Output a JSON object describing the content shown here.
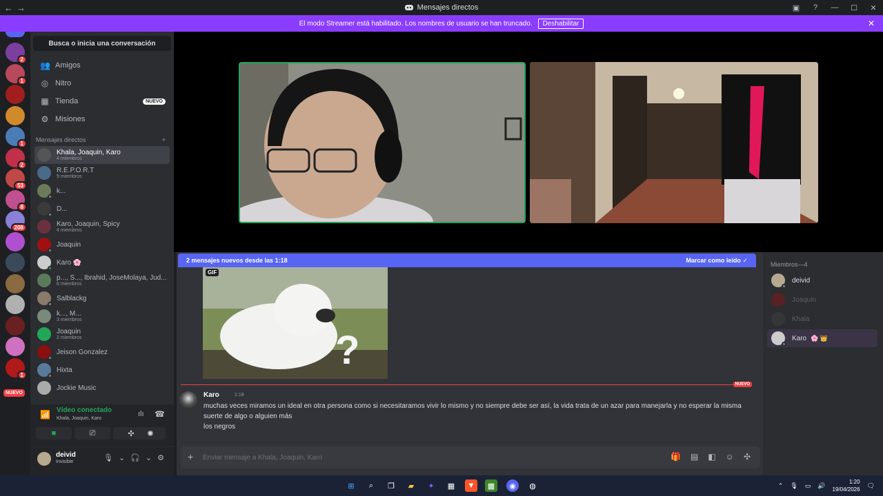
{
  "window": {
    "title": "Mensajes directos",
    "back": "←",
    "forward": "→"
  },
  "banner": {
    "text": "El modo Streamer está habilitado. Los nombres de usuario se han truncado.",
    "button": "Deshabilitar"
  },
  "servers": [
    {
      "badge": "2",
      "color": "#7b3fa0"
    },
    {
      "badge": "1",
      "color": "#b8495c"
    },
    {
      "badge": "",
      "color": "#a01e1e"
    },
    {
      "badge": "",
      "color": "#d08a2c"
    },
    {
      "badge": "1",
      "color": "#4a7db8"
    },
    {
      "badge": "2",
      "color": "#c0304a"
    },
    {
      "badge": "53",
      "color": "#c04848"
    },
    {
      "badge": "8",
      "color": "#c05090"
    },
    {
      "badge": "208",
      "color": "#8a80d8"
    },
    {
      "badge": "",
      "color": "#b050d0"
    },
    {
      "badge": "",
      "color": "#3a4a5a"
    },
    {
      "badge": "",
      "color": "#8a6a40"
    },
    {
      "badge": "",
      "color": "#b0b0b0"
    },
    {
      "badge": "",
      "color": "#6a2020"
    },
    {
      "badge": "",
      "color": "#d070c0"
    },
    {
      "badge": "1",
      "color": "#b01a1a"
    }
  ],
  "servers_new_label": "NUEVO",
  "sidebar": {
    "search_label": "Busca o inicia una conversación",
    "nav": [
      {
        "label": "Amigos",
        "icon": "friends-icon",
        "glyph": "👥",
        "tag": ""
      },
      {
        "label": "Nitro",
        "icon": "nitro-icon",
        "glyph": "◎",
        "tag": ""
      },
      {
        "label": "Tienda",
        "icon": "shop-icon",
        "glyph": "▦",
        "tag": "NUEVO"
      },
      {
        "label": "Misiones",
        "icon": "quests-icon",
        "glyph": "⚙",
        "tag": ""
      }
    ],
    "dm_header": "Mensajes directos",
    "dm_add": "+",
    "dms": [
      {
        "name": "Khala, Joaquin, Karo",
        "sub": "4 miembros",
        "color": "#555",
        "status": "",
        "active": true
      },
      {
        "name": "R.E.P.O.R.T",
        "sub": "9 miembros",
        "color": "#4a6a8a",
        "status": "",
        "active": false
      },
      {
        "name": "k...",
        "sub": "",
        "color": "#6a7a5a",
        "status": "#80848e",
        "active": false
      },
      {
        "name": "D...",
        "sub": "",
        "color": "#3a3a3a",
        "status": "#80848e",
        "active": false
      },
      {
        "name": "Karo, Joaquin, Spicy",
        "sub": "4 miembros",
        "color": "#6a3040",
        "status": "",
        "active": false
      },
      {
        "name": "Joaquin",
        "sub": "",
        "color": "#a01010",
        "status": "#80848e",
        "active": false
      },
      {
        "name": "Karo",
        "sub": "",
        "color": "#ccc",
        "status": "#23a55a",
        "active": false,
        "badge": "🌸"
      },
      {
        "name": "p..., S..., Ibrahid, JoseMolaya, Jud...",
        "sub": "6 miembros",
        "color": "#5a7a5a",
        "status": "",
        "active": false
      },
      {
        "name": "Salblackg",
        "sub": "",
        "color": "#8a7a6a",
        "status": "#80848e",
        "active": false
      },
      {
        "name": "k..., M...",
        "sub": "3 miembros",
        "color": "#7a8a7a",
        "status": "",
        "active": false
      },
      {
        "name": "Joaquin",
        "sub": "2 miembros",
        "color": "#23a55a",
        "status": "",
        "active": false
      },
      {
        "name": "Jeison Gonzalez",
        "sub": "",
        "color": "#8a1010",
        "status": "#80848e",
        "active": false
      },
      {
        "name": "Hixta",
        "sub": "",
        "color": "#5a7a9a",
        "status": "#80848e",
        "active": false
      },
      {
        "name": "Jockie Music",
        "sub": "",
        "color": "#aaa",
        "status": "",
        "active": false
      }
    ]
  },
  "voice": {
    "status": "Vídeo conectado",
    "channel": "Khala, Joaquin, Karo"
  },
  "user": {
    "name": "deivid",
    "status": "Invisible"
  },
  "chat": {
    "new_messages": "2 mensajes nuevos desde las 1:18",
    "mark_read": "Marcar como leído",
    "gif_label": "GIF",
    "new_divider": "NUEVO",
    "message": {
      "author": "Karo",
      "time": "1:18",
      "text1": "muchas veces miramos un ideal en otra persona como si necesitaramos vivir lo mismo y no siempre debe ser así, la vida trata de un azar para manejarla y no esperar la misma suerte de algo o alguien más",
      "text2": "los negros"
    },
    "composer_placeholder": "Enviar mensaje a Khala, Joaquin, Karo",
    "composer_plus": "+"
  },
  "members": {
    "header": "Miembros—4",
    "list": [
      {
        "name": "deivid",
        "online": true,
        "color": "#b7a98e",
        "extra": ""
      },
      {
        "name": "Joaquin",
        "online": false,
        "color": "#a01010",
        "extra": ""
      },
      {
        "name": "Khala",
        "online": false,
        "color": "#444",
        "extra": ""
      },
      {
        "name": "Karo",
        "online": true,
        "color": "#ccc",
        "extra": "🌸 👑"
      }
    ]
  },
  "taskbar": {
    "time": "1:20",
    "date": "19/04/2026"
  }
}
